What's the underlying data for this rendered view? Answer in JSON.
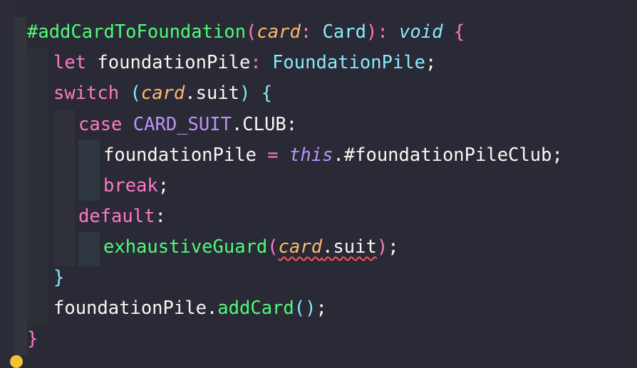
{
  "code": {
    "line1": {
      "method": "#addCardToFoundation",
      "open_paren": "(",
      "param": "card",
      "colon": ": ",
      "type": "Card",
      "close_paren": ")",
      "ret_colon": ": ",
      "ret_type": "void",
      "open_brace": " {"
    },
    "line2": {
      "keyword": "let",
      "name": " foundationPile",
      "colon": ": ",
      "type": "FoundationPile",
      "semi": ";"
    },
    "line3": {
      "keyword": "switch",
      "open_paren": " (",
      "param": "card",
      "prop": ".suit",
      "close_paren": ")",
      "open_brace": " {"
    },
    "line4": {
      "keyword": "case",
      "constant": " CARD_SUIT",
      "member": ".CLUB:"
    },
    "line5": {
      "name": "foundationPile ",
      "op": "=",
      "this_kw": " this",
      "member": ".#foundationPileClub;"
    },
    "line6": {
      "keyword": "break",
      "semi": ";"
    },
    "line7": {
      "keyword": "default",
      "colon": ":"
    },
    "line8": {
      "func": "exhaustiveGuard",
      "open_paren": "(",
      "param": "card",
      "prop": ".suit",
      "close_paren": ")",
      "semi": ";"
    },
    "line9": {
      "close_brace": "}"
    },
    "line10": {
      "name": "foundationPile.",
      "method": "addCard",
      "parens": "()",
      "semi": ";"
    },
    "line11": {
      "close_brace": "}"
    }
  },
  "colors": {
    "background": "#292a35",
    "function": "#50fa7b",
    "keyword": "#ff79c6",
    "parameter": "#ffb86c",
    "type": "#8be9fd",
    "constant": "#bd93f9",
    "error_squiggle": "#ff5555"
  },
  "icons": {
    "lightbulb": "lightbulb-icon"
  }
}
